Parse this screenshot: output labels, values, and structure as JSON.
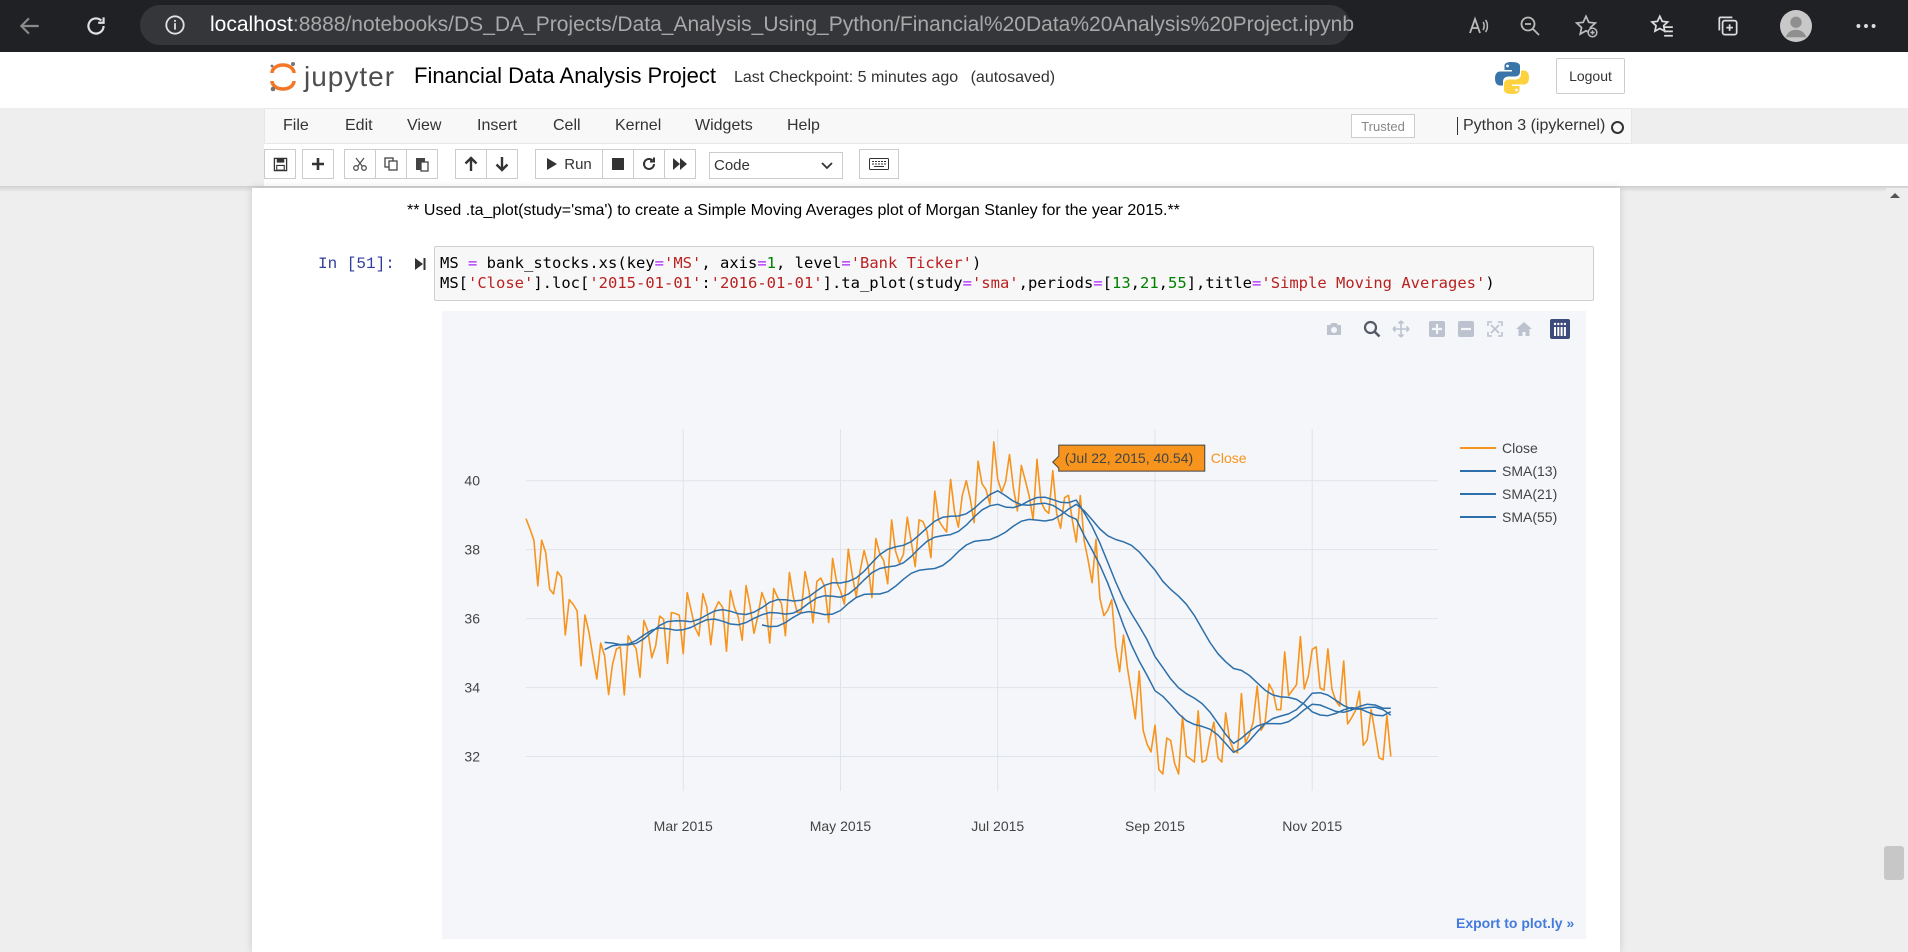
{
  "browser": {
    "url_host": "localhost",
    "url_rest": ":8888/notebooks/DS_DA_Projects/Data_Analysis_Using_Python/Financial%20Data%20Analysis%20Project.ipynb"
  },
  "header": {
    "logo_text": "jupyter",
    "notebook_title": "Financial Data Analysis Project",
    "checkpoint": "Last Checkpoint: 5 minutes ago",
    "autosaved": "(autosaved)",
    "logout_label": "Logout"
  },
  "menubar": {
    "items": [
      "File",
      "Edit",
      "View",
      "Insert",
      "Cell",
      "Kernel",
      "Widgets",
      "Help"
    ],
    "trusted_label": "Trusted",
    "kernel_name": "Python 3 (ipykernel)"
  },
  "toolbar": {
    "run_label": "Run",
    "cell_type": "Code"
  },
  "cell": {
    "markdown_text": "** Used .ta_plot(study='sma') to create a Simple Moving Averages plot of Morgan Stanley for the year 2015.**",
    "prompt": "In [51]:"
  },
  "plot": {
    "export_label": "Export to plot.ly »",
    "hover_label": "(Jul 22, 2015, 40.54)",
    "hover_series": "Close"
  },
  "colors": {
    "close": "#f7941d",
    "sma": "#2c6faa",
    "hover_bg": "#f7941d"
  },
  "chart_data": {
    "type": "line",
    "title": "",
    "xlabel": "",
    "ylabel": "",
    "ylim": [
      31,
      41.5
    ],
    "x_ticks": [
      "Mar 2015",
      "May 2015",
      "Jul 2015",
      "Sep 2015",
      "Nov 2015"
    ],
    "y_ticks": [
      32,
      34,
      36,
      38,
      40
    ],
    "legend": [
      "Close",
      "SMA(13)",
      "SMA(21)",
      "SMA(55)"
    ],
    "legend_position": "top-right",
    "grid": true,
    "series": [
      {
        "name": "Close",
        "x": [
          "Jan 2015",
          "Feb 2015",
          "Mar 2015",
          "Apr 2015",
          "May 2015",
          "Jun 2015",
          "Jul 2015",
          "Aug 2015",
          "Sep 2015",
          "Oct 2015",
          "Nov 2015",
          "Dec 2015"
        ],
        "values": [
          38.5,
          34.5,
          36.0,
          36.2,
          37.0,
          38.4,
          40.2,
          39.0,
          32.0,
          32.5,
          34.8,
          32.0
        ]
      },
      {
        "name": "SMA(13)",
        "x": [
          "Feb 2015",
          "Mar 2015",
          "Apr 2015",
          "May 2015",
          "Jun 2015",
          "Jul 2015",
          "Aug 2015",
          "Sep 2015",
          "Oct 2015",
          "Nov 2015",
          "Dec 2015"
        ],
        "values": [
          35.0,
          36.0,
          36.3,
          37.0,
          38.5,
          39.6,
          39.0,
          33.8,
          32.2,
          33.8,
          33.2
        ]
      },
      {
        "name": "SMA(21)",
        "x": [
          "Feb 2015",
          "Mar 2015",
          "Apr 2015",
          "May 2015",
          "Jun 2015",
          "Jul 2015",
          "Aug 2015",
          "Sep 2015",
          "Oct 2015",
          "Nov 2015",
          "Dec 2015"
        ],
        "values": [
          35.2,
          35.8,
          36.0,
          36.7,
          38.0,
          39.3,
          39.5,
          34.8,
          32.5,
          33.4,
          33.4
        ]
      },
      {
        "name": "SMA(55)",
        "x": [
          "Apr 2015",
          "May 2015",
          "Jun 2015",
          "Jul 2015",
          "Aug 2015",
          "Sep 2015",
          "Oct 2015",
          "Nov 2015",
          "Dec 2015"
        ],
        "values": [
          35.8,
          36.3,
          37.3,
          38.5,
          39.2,
          37.5,
          34.5,
          33.3,
          33.3
        ]
      }
    ]
  }
}
